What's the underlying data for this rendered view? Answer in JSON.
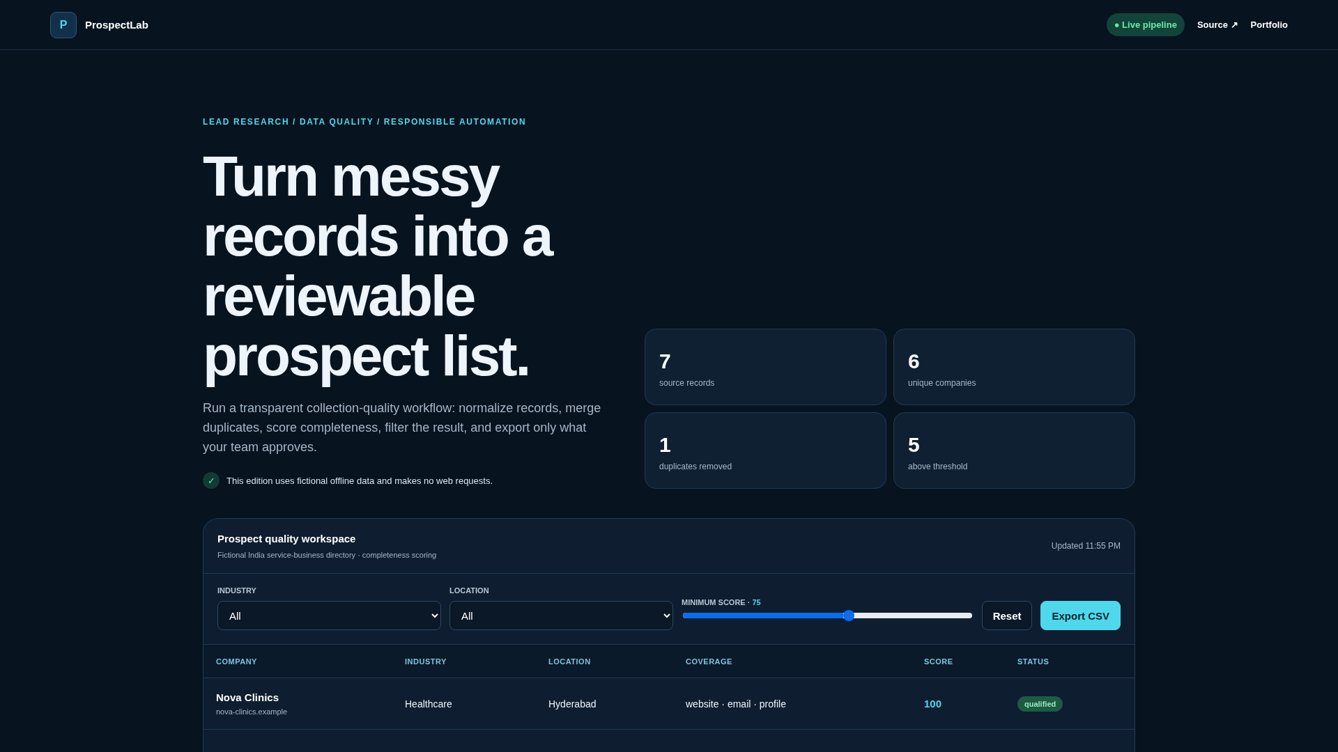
{
  "brand": {
    "mark": "P",
    "name": "ProspectLab"
  },
  "nav": {
    "status": {
      "label": "● Live pipeline",
      "on": true
    },
    "links": [
      "Source ↗",
      "Portfolio"
    ]
  },
  "hero": {
    "eyebrow": "LEAD RESEARCH / DATA QUALITY / RESPONSIBLE AUTOMATION",
    "headline": "Turn messy records into a reviewable prospect list.",
    "description": "Run a transparent collection-quality workflow: normalize records, merge duplicates, score completeness, filter the result, and export only what your team approves.",
    "note": {
      "icon": "✓",
      "text": "This edition uses fictional offline data and makes no web requests."
    }
  },
  "stats": [
    {
      "value": "7",
      "label": "source records"
    },
    {
      "value": "6",
      "label": "unique companies"
    },
    {
      "value": "1",
      "label": "duplicates removed"
    },
    {
      "value": "5",
      "label": "above threshold"
    }
  ],
  "workspace": {
    "title": "Prospect quality workspace",
    "subtitle": "Fictional India service-business directory · completeness scoring",
    "updated": "Updated 11:55 PM",
    "filters": [
      {
        "label": "INDUSTRY",
        "value": "All"
      },
      {
        "label": "LOCATION",
        "value": "All"
      }
    ],
    "min_score": {
      "label": "MINIMUM SCORE · ",
      "value": "75",
      "level": 0.575
    },
    "buttons": [
      {
        "label": "Reset",
        "kind": "secondary"
      },
      {
        "label": "Export CSV",
        "kind": "primary"
      }
    ],
    "table": {
      "columns": [
        "COMPANY",
        "INDUSTRY",
        "LOCATION",
        "COVERAGE",
        "SCORE",
        "STATUS"
      ],
      "rows": [
        {
          "company": "Nova Clinics",
          "domain": "nova-clinics.example",
          "industry": "Healthcare",
          "location": "Hyderabad",
          "coverage": "website · email · profile",
          "score": "100",
          "status": "qualified",
          "color": "#1f5a44"
        }
      ]
    }
  }
}
